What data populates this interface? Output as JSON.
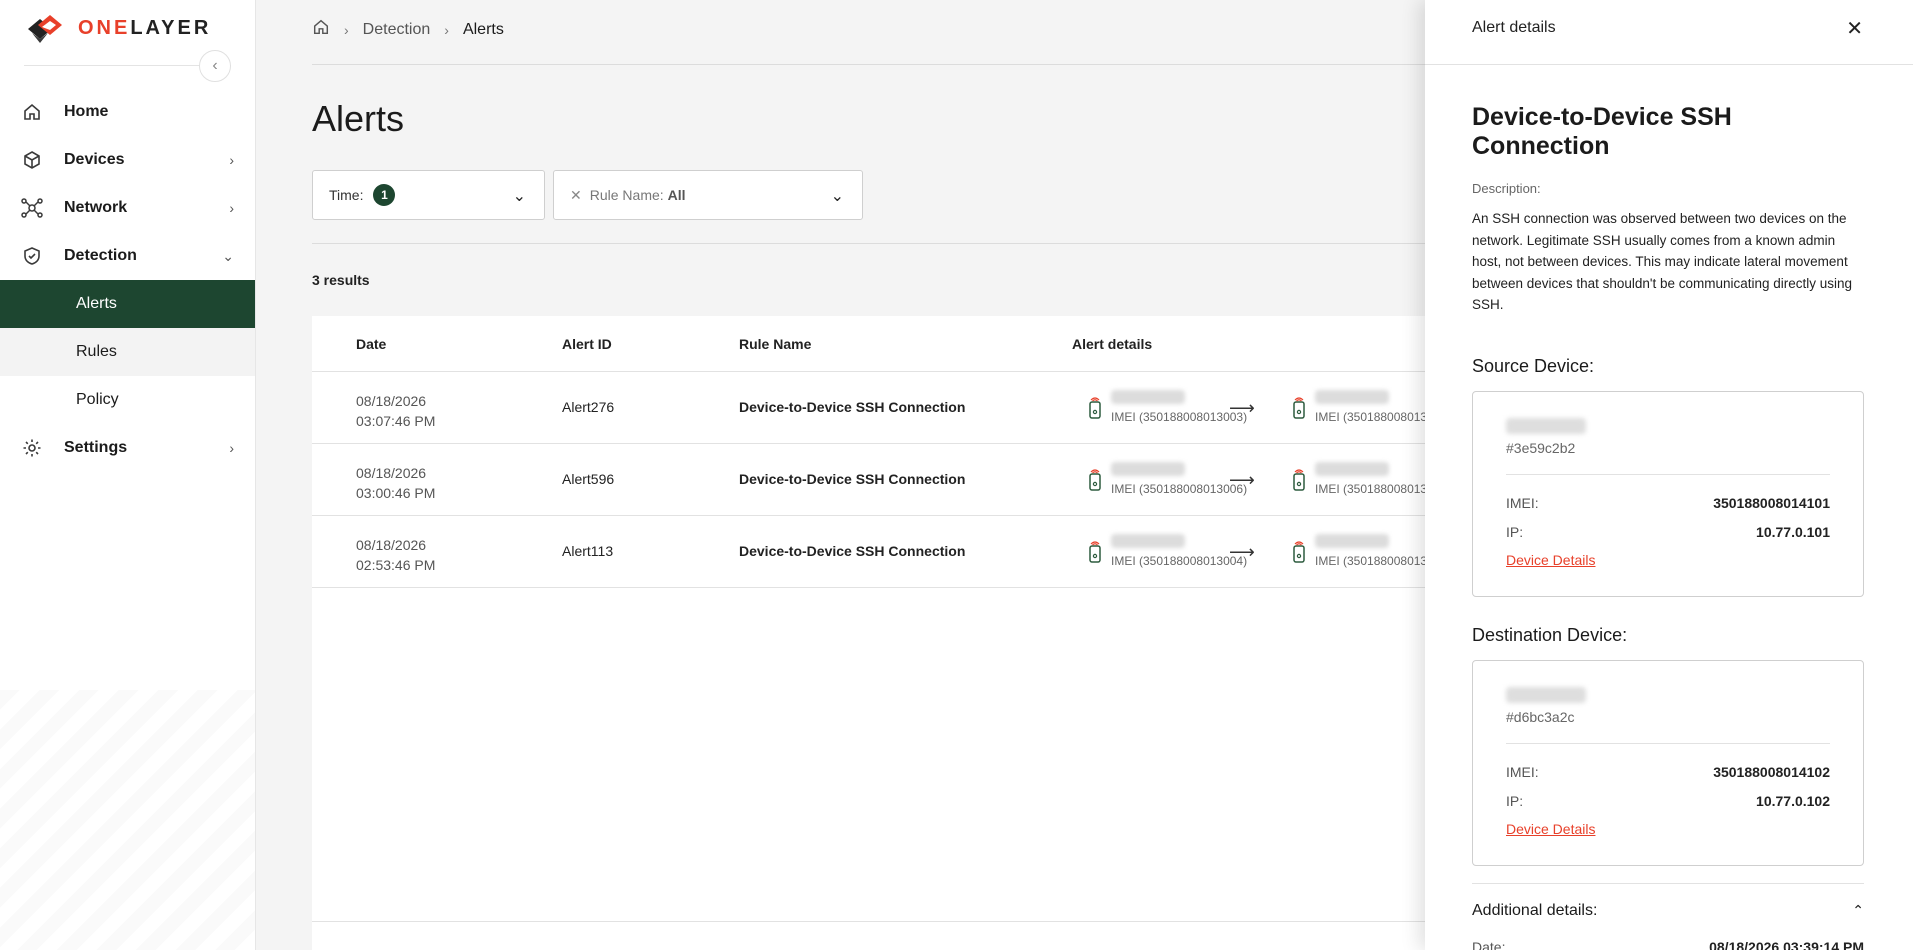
{
  "brand": {
    "one": "ONE",
    "layer": "LAYER",
    "accent": "#e8402a",
    "primary": "#1d4630"
  },
  "sidebar": {
    "items": [
      {
        "label": "Home",
        "icon": "home-icon"
      },
      {
        "label": "Devices",
        "icon": "cube-icon"
      },
      {
        "label": "Network",
        "icon": "network-icon"
      },
      {
        "label": "Detection",
        "icon": "shield-icon"
      },
      {
        "label": "Settings",
        "icon": "gear-icon"
      }
    ],
    "detection_children": [
      {
        "label": "Alerts",
        "active": true
      },
      {
        "label": "Rules"
      },
      {
        "label": "Policy"
      }
    ]
  },
  "breadcrumb": {
    "items": [
      "Detection",
      "Alerts"
    ]
  },
  "page": {
    "title": "Alerts",
    "results": "3 results"
  },
  "filters": {
    "time_label": "Time:",
    "time_badge": "1",
    "rule_label": "Rule Name:",
    "rule_value": "All"
  },
  "table": {
    "columns": [
      "Date",
      "Alert ID",
      "Rule Name",
      "Alert details"
    ],
    "rows": [
      {
        "date": "08/18/2026",
        "time": "03:07:46 PM",
        "id": "Alert276",
        "rule": "Device-to-Device SSH Connection",
        "src_imei": "IMEI (350188008013003)",
        "dst_imei": "IMEI (350188008013"
      },
      {
        "date": "08/18/2026",
        "time": "03:00:46 PM",
        "id": "Alert596",
        "rule": "Device-to-Device SSH Connection",
        "src_imei": "IMEI (350188008013006)",
        "dst_imei": "IMEI (350188008013"
      },
      {
        "date": "08/18/2026",
        "time": "02:53:46 PM",
        "id": "Alert113",
        "rule": "Device-to-Device SSH Connection",
        "src_imei": "IMEI (350188008013004)",
        "dst_imei": "IMEI (350188008013"
      }
    ]
  },
  "panel": {
    "header": "Alert details",
    "title": "Device-to-Device SSH Connection",
    "description_label": "Description:",
    "description": "An SSH connection was observed between two devices on the network. Legitimate SSH usually comes from a known admin host, not between devices. This may indicate lateral movement between devices that shouldn't be communicating directly using SSH.",
    "source": {
      "section_title": "Source Device:",
      "hash": "#3e59c2b2",
      "imei_label": "IMEI:",
      "imei": "350188008014101",
      "ip_label": "IP:",
      "ip": "10.77.0.101",
      "link": "Device Details"
    },
    "destination": {
      "section_title": "Destination Device:",
      "hash": "#d6bc3a2c",
      "imei_label": "IMEI:",
      "imei": "350188008014102",
      "ip_label": "IP:",
      "ip": "10.77.0.102",
      "link": "Device Details"
    },
    "additional": {
      "title": "Additional details:",
      "date_label": "Date:",
      "date_value": "08/18/2026 03:39:14 PM"
    }
  }
}
